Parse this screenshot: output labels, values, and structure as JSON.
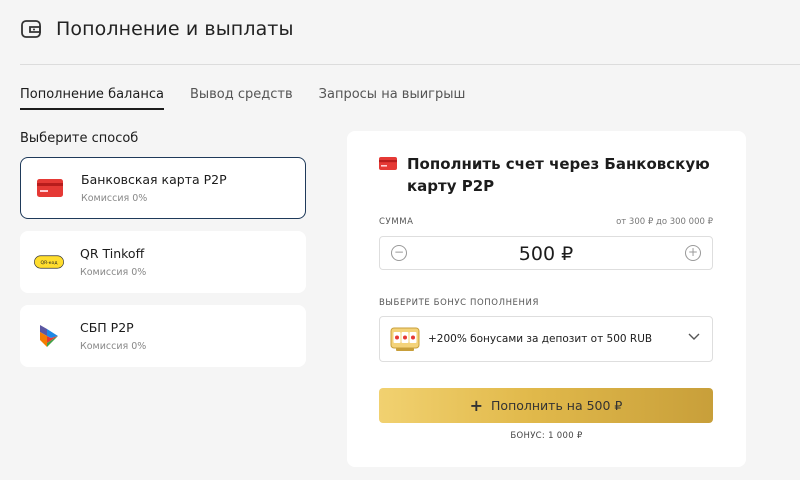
{
  "header": {
    "title": "Пополнение и выплаты",
    "icon": "wallet-icon"
  },
  "tabs": [
    {
      "label": "Пополнение баланса",
      "active": true
    },
    {
      "label": "Вывод средств",
      "active": false
    },
    {
      "label": "Запросы на выигрыш",
      "active": false
    }
  ],
  "methods": {
    "heading": "Выберите способ",
    "items": [
      {
        "name": "Банковская карта P2P",
        "fee": "Комиссия 0%",
        "icon": "bank-card-icon",
        "selected": true
      },
      {
        "name": "QR Tinkoff",
        "fee": "Комиссия 0%",
        "icon": "qr-code-icon",
        "icon_text": "QR-код",
        "selected": false
      },
      {
        "name": "СБП P2P",
        "fee": "Комиссия 0%",
        "icon": "sbp-icon",
        "selected": false
      }
    ]
  },
  "deposit": {
    "title": "Пополнить счет через Банковскую карту P2P",
    "amount_label": "СУММА",
    "range": "от 300 ₽ до 300 000 ₽",
    "amount": "500 ₽",
    "bonus_label": "ВЫБЕРИТЕ БОНУС ПОПОЛНЕНИЯ",
    "bonus_option": "+200% бонусами за депозит от 500 RUB",
    "pay_button": "Пополнить на 500 ₽",
    "bonus_total": "БОНУС: 1 000 ₽"
  },
  "colors": {
    "accent_gold": "#e1b94b",
    "selected_border": "#1f3a5a",
    "card_red": "#e53935",
    "background": "#f5f5f5"
  }
}
